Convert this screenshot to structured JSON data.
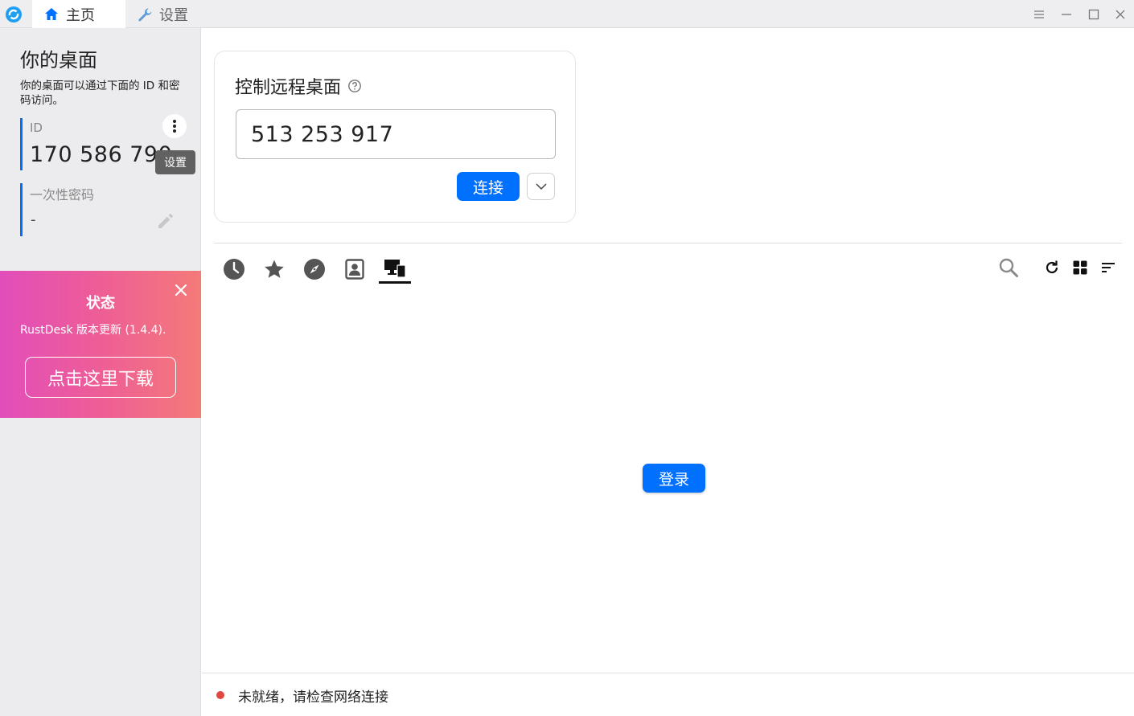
{
  "titlebar": {
    "tabs": [
      {
        "label": "主页",
        "icon": "home-icon",
        "active": true
      },
      {
        "label": "设置",
        "icon": "wrench-icon",
        "active": false
      }
    ],
    "window_controls": [
      "menu-icon",
      "minimize-icon",
      "maximize-icon",
      "close-icon"
    ]
  },
  "left_panel": {
    "title": "你的桌面",
    "description": "你的桌面可以通过下面的 ID 和密码访问。",
    "id_label": "ID",
    "id_value": "170 586 790",
    "tooltip": "设置",
    "password_label": "一次性密码",
    "password_value": "-"
  },
  "status_banner": {
    "title": "状态",
    "message": "RustDesk 版本更新 (1.4.4).",
    "button": "点击这里下载"
  },
  "connect": {
    "title": "控制远程桌面",
    "input_value": "513 253 917",
    "connect_button": "连接"
  },
  "peer_tabs": [
    {
      "icon": "clock-icon",
      "active": false
    },
    {
      "icon": "star-icon",
      "active": false
    },
    {
      "icon": "compass-icon",
      "active": false
    },
    {
      "icon": "address-book-icon",
      "active": false
    },
    {
      "icon": "devices-icon",
      "active": true
    }
  ],
  "toolbar_icons": [
    "search-icon",
    "refresh-icon",
    "grid-view-icon",
    "sort-icon"
  ],
  "main": {
    "login_button": "登录"
  },
  "footer": {
    "status_text": "未就绪，请检查网络连接",
    "status_color": "#e0473f"
  },
  "colors": {
    "accent": "#0071ff",
    "banner_gradient": [
      "#e24dba",
      "#f47a78"
    ]
  }
}
